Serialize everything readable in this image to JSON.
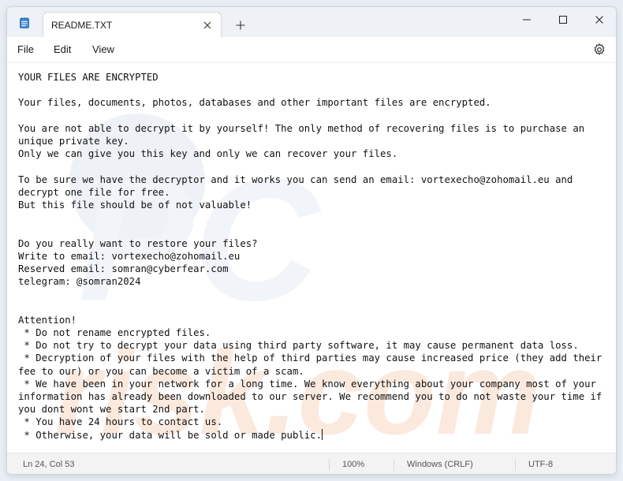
{
  "window": {
    "tab_title": "README.TXT"
  },
  "menu": {
    "file": "File",
    "edit": "Edit",
    "view": "View"
  },
  "editor": {
    "text": "YOUR FILES ARE ENCRYPTED\n\nYour files, documents, photos, databases and other important files are encrypted.\n\nYou are not able to decrypt it by yourself! The only method of recovering files is to purchase an unique private key.\nOnly we can give you this key and only we can recover your files.\n\nTo be sure we have the decryptor and it works you can send an email: vortexecho@zohomail.eu and decrypt one file for free.\nBut this file should be of not valuable!\n\n\nDo you really want to restore your files?\nWrite to email: vortexecho@zohomail.eu\nReserved email: somran@cyberfear.com\ntelegram: @somran2024\n\n\nAttention!\n * Do not rename encrypted files.\n * Do not try to decrypt your data using third party software, it may cause permanent data loss.\n * Decryption of your files with the help of third parties may cause increased price (they add their fee to our) or you can become a victim of a scam.\n * We have been in your network for a long time. We know everything about your company most of your information has already been downloaded to our server. We recommend you to do not waste your time if you dont wont we start 2nd part.\n * You have 24 hours to contact us.\n * Otherwise, your data will be sold or made public.",
    "watermark": "pcrisk.com"
  },
  "status": {
    "position": "Ln 24, Col 53",
    "zoom": "100%",
    "line_endings": "Windows (CRLF)",
    "encoding": "UTF-8"
  },
  "icons": {
    "app": "notepad-icon",
    "tab_close": "close-icon",
    "new_tab": "plus-icon",
    "minimize": "minimize-icon",
    "maximize": "maximize-icon",
    "close": "close-icon",
    "settings": "gear-icon"
  },
  "colors": {
    "titlebar_bg": "#eef1f5",
    "editor_bg": "#ffffff",
    "statusbar_bg": "#f3f3f3",
    "text": "#111111"
  }
}
